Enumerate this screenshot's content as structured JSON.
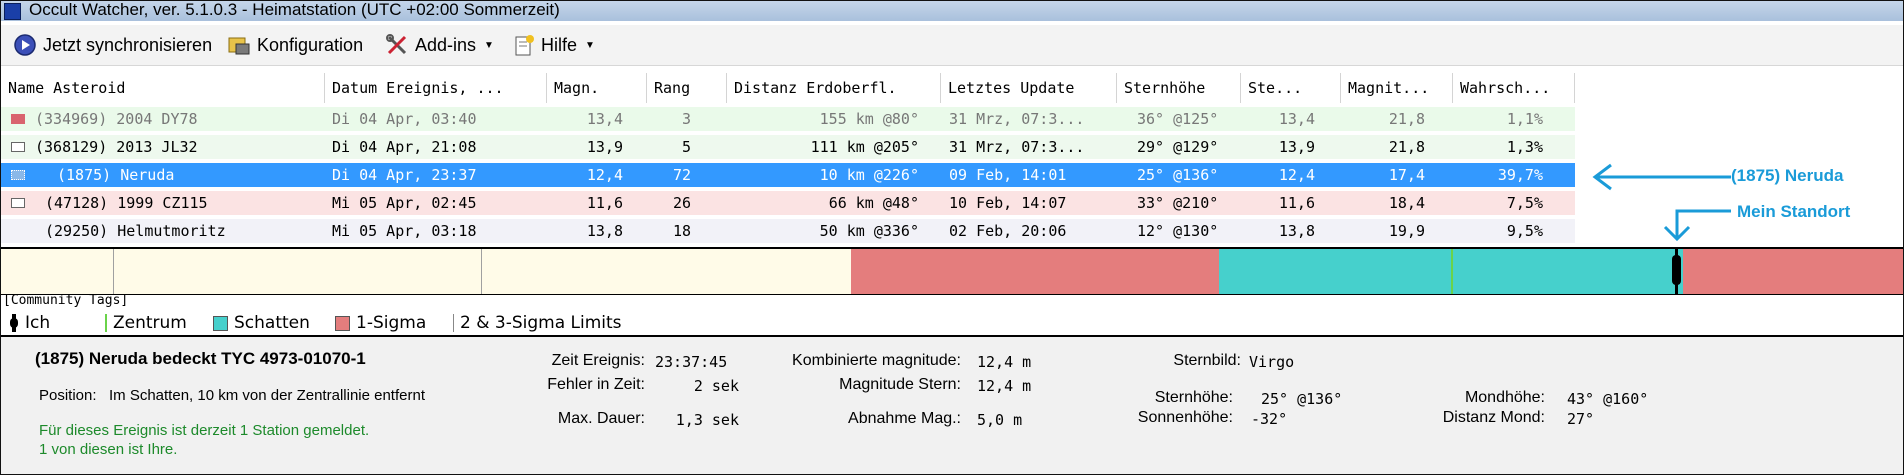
{
  "window": {
    "title": "Occult Watcher, ver. 5.1.0.3 - Heimatstation (UTC +02:00 Sommerzeit)"
  },
  "toolbar": {
    "sync_label": "Jetzt synchronisieren",
    "config_label": "Konfiguration",
    "addins_label": "Add-ins",
    "help_label": "Hilfe"
  },
  "table": {
    "columns": [
      "Name Asteroid",
      "Datum Ereignis, ...",
      "Magn.",
      "Rang",
      "Distanz Erdoberfl.",
      "Letztes Update",
      "Sternhöhe",
      "Ste...",
      "Magnit...",
      "Wahrsch..."
    ],
    "rows": [
      {
        "name": "(334969) 2004 DY78",
        "date": "Di 04 Apr, 03:40",
        "magn": "13,4",
        "rank": "3",
        "dist": "155 km @80°",
        "update": "31 Mrz, 07:3...",
        "alt": "36° @125°",
        "ste": "13,4",
        "magnit": "21,8",
        "prob": "1,1%"
      },
      {
        "name": "(368129) 2013 JL32",
        "date": "Di 04 Apr, 21:08",
        "magn": "13,9",
        "rank": "5",
        "dist": "111 km @205°",
        "update": "31 Mrz, 07:3...",
        "alt": "29° @129°",
        "ste": "13,9",
        "magnit": "21,8",
        "prob": "1,3%"
      },
      {
        "name": "(1875) Neruda",
        "date": "Di 04 Apr, 23:37",
        "magn": "12,4",
        "rank": "72",
        "dist": "10 km @226°",
        "update": "09 Feb, 14:01",
        "alt": "25° @136°",
        "ste": "12,4",
        "magnit": "17,4",
        "prob": "39,7%"
      },
      {
        "name": "(47128) 1999 CZ115",
        "date": "Mi 05 Apr, 02:45",
        "magn": "11,6",
        "rank": "26",
        "dist": "66 km @48°",
        "update": "10 Feb, 14:07",
        "alt": "33° @210°",
        "ste": "11,6",
        "magnit": "18,4",
        "prob": "7,5%"
      },
      {
        "name": "(29250) Helmutmoritz",
        "date": "Mi 05 Apr, 03:18",
        "magn": "13,8",
        "rank": "18",
        "dist": "50 km @336°",
        "update": "02 Feb, 20:06",
        "alt": "12° @130°",
        "ste": "13,8",
        "magnit": "19,9",
        "prob": "9,5%"
      }
    ]
  },
  "annotations": {
    "neruda": "(1875) Neruda",
    "location": "Mein Standort"
  },
  "tags": {
    "label": "[Community Tags]"
  },
  "legend": {
    "me": "Ich",
    "center": "Zentrum",
    "shadow": "Schatten",
    "sigma1": "1-Sigma",
    "sigma23": "2 & 3-Sigma Limits"
  },
  "details": {
    "heading": "(1875) Neruda bedeckt TYC 4973-01070-1",
    "position_label": "Position:",
    "position_value": "Im Schatten, 10 km von der Zentrallinie entfernt",
    "status_line1": "Für dieses Ereignis ist derzeit 1 Station gemeldet.",
    "status_line2": "1 von diesen ist Ihre.",
    "time_label": "Zeit Ereignis:",
    "time_value": "23:37:45",
    "err_label": "Fehler in Zeit:",
    "err_value": "2 sek",
    "dur_label": "Max. Dauer:",
    "dur_value": "1,3 sek",
    "combmag_label": "Kombinierte magnitude:",
    "combmag_value": "12,4 m",
    "starmag_label": "Magnitude Stern:",
    "starmag_value": "12,4 m",
    "drop_label": "Abnahme Mag.:",
    "drop_value": "5,0 m",
    "const_label": "Sternbild:",
    "const_value": "Virgo",
    "staralt_label": "Sternhöhe:",
    "staralt_value": "25° @136°",
    "sunalt_label": "Sonnenhöhe:",
    "sunalt_value": "-32°",
    "moonalt_label": "Mondhöhe:",
    "moonalt_value": "43° @160°",
    "moondist_label": "Distanz Mond:",
    "moondist_value": "27°"
  },
  "colors": {
    "row1": "#eafaea",
    "row2": "#eef9ee",
    "selected": "#3399ff",
    "row4": "#fbe3e3",
    "row5": "#f2f2f8",
    "sigma": "#e47d7d",
    "shadow": "#46d0cc",
    "callout": "#1a9bd8",
    "status_green": "#1d8a2b"
  },
  "icons": {
    "sync": "sync-disc-icon",
    "config": "config-icon",
    "addins": "tools-icon",
    "help": "help-icon"
  }
}
